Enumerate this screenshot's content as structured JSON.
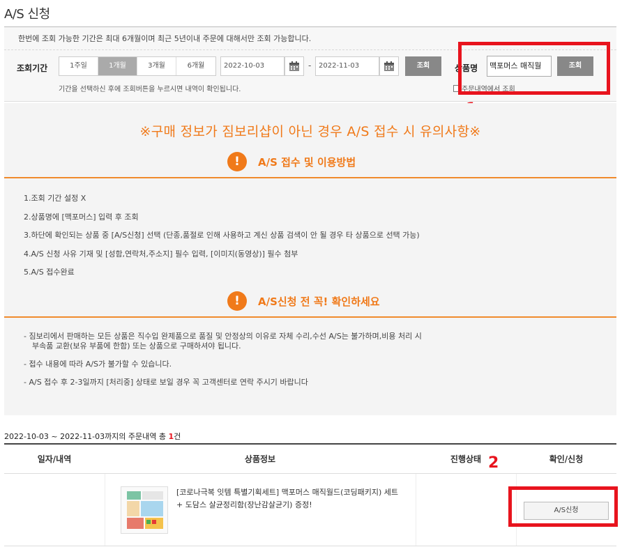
{
  "page": {
    "title": "A/S 신청"
  },
  "search": {
    "notice": "한번에 조회 가능한 기간은 최대 6개월이며 최근 5년이내 주문에 대해서만 조회 가능합니다.",
    "period_label": "조회기간",
    "period_tabs": [
      "1주일",
      "1개월",
      "3개월",
      "6개월"
    ],
    "active_tab": "1개월",
    "start_date": "2022-10-03",
    "date_separator": "-",
    "end_date": "2022-11-03",
    "search_button": "조회",
    "hint": "기간을 선택하신 후에 조회버튼을 누르시면 내역이 확인됩니다.",
    "product_label": "상품명",
    "product_value": "맥포머스 매직월",
    "product_button": "조회",
    "checkbox_label": "주문내역에서 조회"
  },
  "annotations": {
    "one": "1",
    "two": "2",
    "color": "#e8141e"
  },
  "info": {
    "warning_title": "※구매 정보가 짐보리샵이 아닌 경우 A/S 접수 시 유의사항※",
    "section1_icon": "!",
    "section1_title": "A/S 접수 및 이용방법",
    "steps": [
      "1.조회 기간 설정 X",
      "2.상품명에 [맥포머스] 입력 후 조회",
      "3.하단에 확인되는 상품 중 [A/S신청] 선택 (단종,품절로 인해 사용하고 계신 상품 검색이 안 될 경우 타 상품으로 선택 가능)",
      "4.A/S 신청 사유 기재 및 [성함,연락처,주소지] 필수 입력, [이미지(동영상)] 필수 첨부",
      "5.A/S 접수완료"
    ],
    "section2_icon": "!",
    "section2_title": "A/S신청 전 꼭! 확인하세요",
    "notes": {
      "n1_line1": "- 짐보리에서 판매하는 모든 상품은 직수입 완제품으로 품질 및 안정상의 이유로 자체 수리,수선 A/S는 불가하며,비용 처리 시",
      "n1_line2": "부속품 교환(보유 부품에 한함) 또는 상품으로 구매하셔야 됩니다.",
      "n2": "- 접수 내용에 따라 A/S가 불가할 수 있습니다.",
      "n3": "- A/S 접수 후 2-3일까지 [처리중] 상태로 보일 경우 꼭 고객센터로 연락 주시기 바랍니다"
    },
    "accent_color": "#f07a1a"
  },
  "summary": {
    "range": "2022-10-03 ~ 2022-11-03까지의 주문내역 총 ",
    "count": "1",
    "suffix": "건"
  },
  "table": {
    "headers": [
      "일자/내역",
      "상품정보",
      "진행상태",
      "확인/신청"
    ],
    "row": {
      "date": "",
      "product": "[코로나극복 잇템 특별기획세트] 맥포머스 매직월드(코딩패키지) 세트 + 도담스 살균정리함(장난감살균기) 증정!",
      "status": "",
      "action": "A/S신청"
    }
  }
}
